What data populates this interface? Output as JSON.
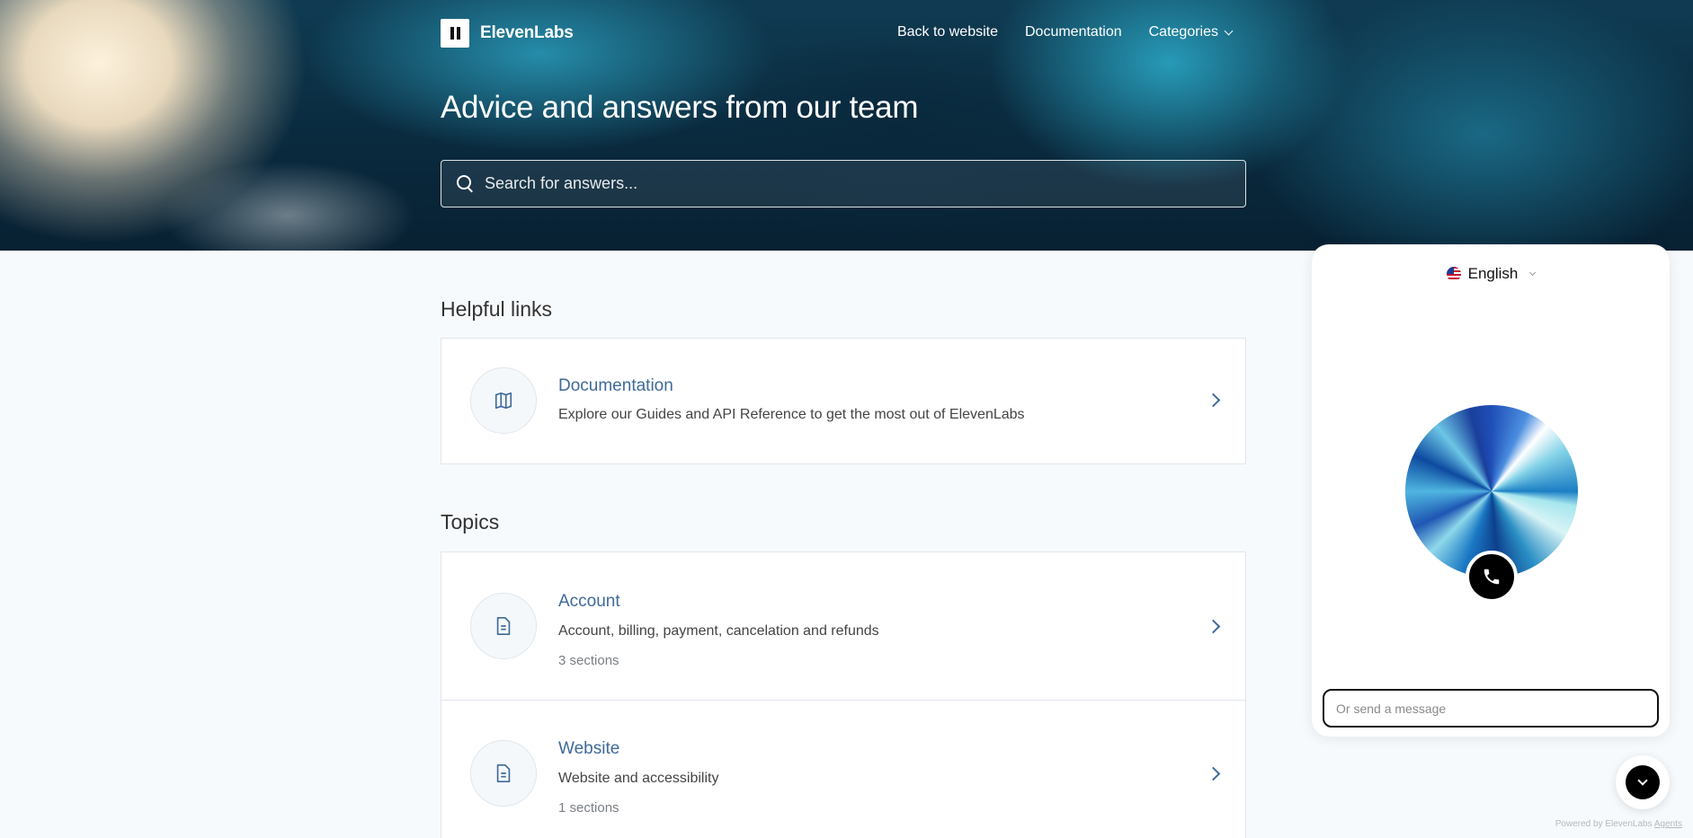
{
  "header": {
    "brand": "ElevenLabs",
    "nav": [
      {
        "label": "Back to website"
      },
      {
        "label": "Documentation"
      },
      {
        "label": "Categories"
      }
    ],
    "title": "Advice and answers from our team",
    "search_placeholder": "Search for answers..."
  },
  "helpful_links": {
    "title": "Helpful links",
    "items": [
      {
        "title": "Documentation",
        "description": "Explore our Guides and API Reference to get the most out of ElevenLabs",
        "icon": "map-icon"
      }
    ]
  },
  "topics": {
    "title": "Topics",
    "items": [
      {
        "title": "Account",
        "description": "Account, billing, payment, cancelation and refunds",
        "meta": "3 sections",
        "icon": "document-icon"
      },
      {
        "title": "Website",
        "description": "Website and accessibility",
        "meta": "1 sections",
        "icon": "document-icon"
      }
    ]
  },
  "widget": {
    "language": "English",
    "message_placeholder": "Or send a message",
    "powered_prefix": "Powered by ElevenLabs",
    "powered_link": "Agents"
  },
  "colors": {
    "link": "#3f6a9a",
    "page_bg": "#f7fafd",
    "hero_dark": "#0a2a3e"
  }
}
